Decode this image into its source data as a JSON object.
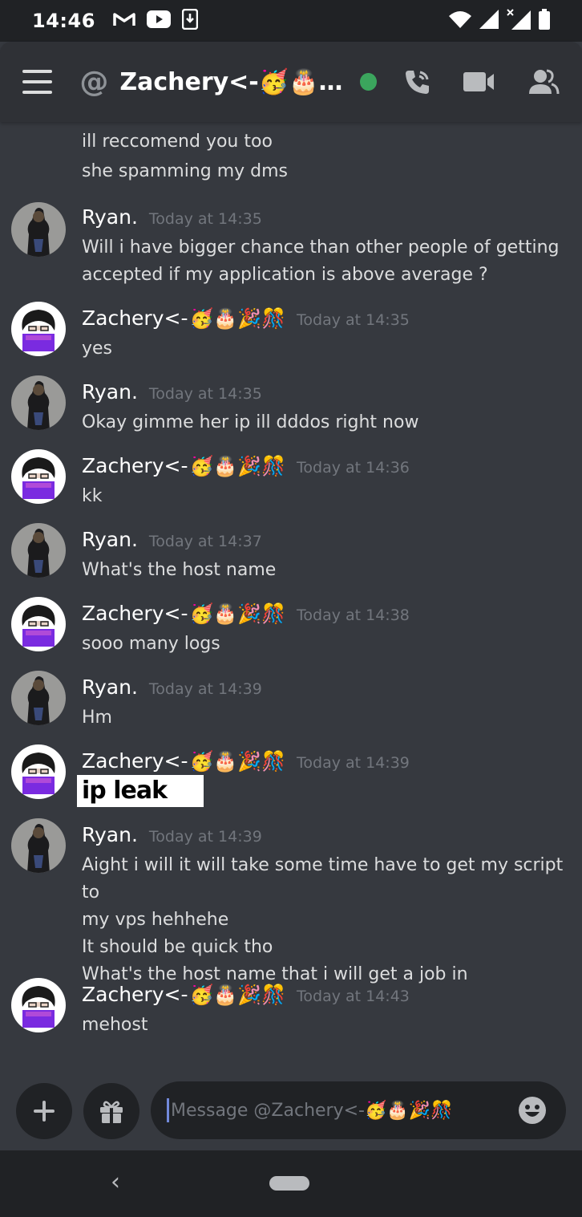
{
  "status_bar": {
    "time": "14:46",
    "left_icons": [
      "gmail-icon",
      "youtube-icon",
      "download-icon"
    ],
    "right_icons": [
      "wifi-icon",
      "signal-icon",
      "signal-x-icon",
      "battery-icon"
    ]
  },
  "header": {
    "title": "Zachery<-🥳🎂…",
    "online_color": "#3ba55d"
  },
  "continuation_lines": [
    "ill reccomend you too",
    "she spamming my dms"
  ],
  "messages": [
    {
      "author": "Ryan.",
      "emojis": "",
      "timestamp": "Today at 14:35",
      "lines": [
        "Will i have bigger chance than other people of getting",
        "accepted if my application is above average ?"
      ]
    },
    {
      "author": "Zachery<-",
      "emojis": "🥳🎂🎉🎊",
      "timestamp": "Today at 14:35",
      "lines": [
        "yes"
      ]
    },
    {
      "author": "Ryan.",
      "emojis": "",
      "timestamp": "Today at 14:35",
      "lines": [
        "Okay gimme her ip ill dddos right now"
      ]
    },
    {
      "author": "Zachery<-",
      "emojis": "🥳🎂🎉🎊",
      "timestamp": "Today at 14:36",
      "lines": [
        "kk"
      ]
    },
    {
      "author": "Ryan.",
      "emojis": "",
      "timestamp": "Today at 14:37",
      "lines": [
        "What's the host name"
      ]
    },
    {
      "author": "Zachery<-",
      "emojis": "🥳🎂🎉🎊",
      "timestamp": "Today at 14:38",
      "lines": [
        "sooo many logs"
      ]
    },
    {
      "author": "Ryan.",
      "emojis": "",
      "timestamp": "Today at 14:39",
      "lines": [
        "Hm"
      ]
    },
    {
      "author": "Zachery<-",
      "emojis": "🥳🎂🎉🎊",
      "timestamp": "Today at 14:39",
      "overlay": "ip leak"
    },
    {
      "author": "Ryan.",
      "emojis": "",
      "timestamp": "Today at 14:39",
      "lines": [
        "Aight i will it will take some time have to get my script to",
        "my vps hehhehe",
        "It should be quick tho",
        "What's the host name that i will get a job in"
      ]
    },
    {
      "author": "Zachery<-",
      "emojis": "🥳🎂🎉🎊",
      "timestamp": "Today at 14:43",
      "lines": [
        "mehost"
      ]
    }
  ],
  "composer": {
    "placeholder": "Message @Zachery<-🥳🎂🎉🎊"
  }
}
